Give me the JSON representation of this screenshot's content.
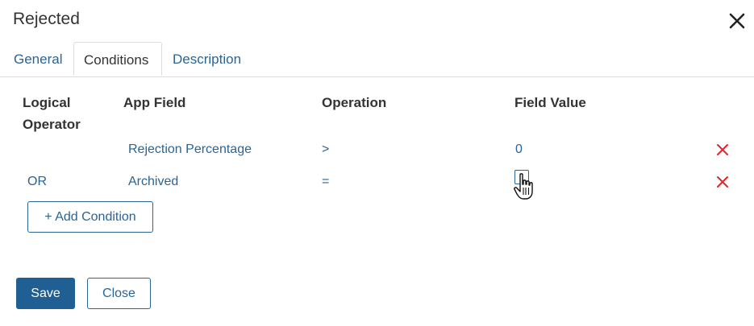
{
  "dialog": {
    "title": "Rejected"
  },
  "tabs": [
    {
      "label": "General"
    },
    {
      "label": "Conditions"
    },
    {
      "label": "Description"
    }
  ],
  "headers": {
    "logical_operator_line1": "Logical",
    "logical_operator_line2": "Operator",
    "app_field": "App Field",
    "operation": "Operation",
    "field_value": "Field Value"
  },
  "rows": [
    {
      "logical_operator": "",
      "app_field": "Rejection Percentage",
      "operation": ">",
      "field_value": "0"
    },
    {
      "logical_operator": "OR",
      "app_field": "Archived",
      "operation": "=",
      "field_value_checked": false
    }
  ],
  "buttons": {
    "add_condition": "+ Add Condition",
    "save": "Save",
    "close": "Close"
  },
  "colors": {
    "link": "#2a6496",
    "primary_button": "#1f5f94",
    "delete": "#e0262b"
  },
  "icons": {
    "close": "close-icon",
    "delete": "delete-x-icon",
    "cursor": "hand-pointer-icon"
  }
}
